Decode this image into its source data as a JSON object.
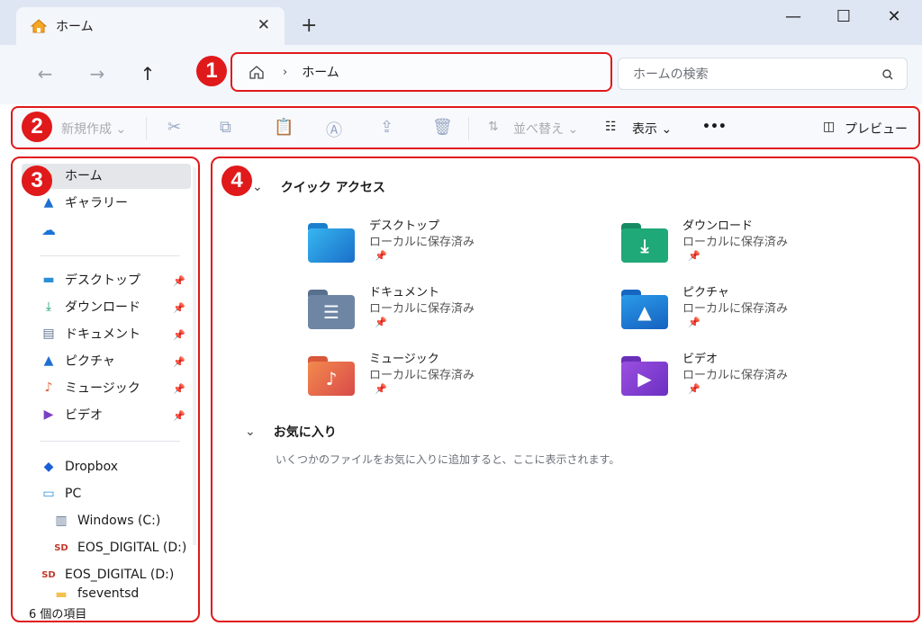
{
  "tab": {
    "title": "ホーム",
    "close": "✕",
    "new": "+"
  },
  "window": {
    "minimize": "—",
    "maximize": "☐",
    "close": "✕"
  },
  "nav": {
    "back": "←",
    "forward": "→",
    "up": "↑"
  },
  "address": {
    "sep": "›",
    "crumb": "ホーム"
  },
  "search": {
    "placeholder": "ホームの検索"
  },
  "markers": {
    "m1": "1",
    "m2": "2",
    "m3": "3",
    "m4": "4"
  },
  "toolbar": {
    "new_label": "新規作成 ⌄",
    "sort_label": "並べ替え ⌄",
    "view_label": "表示 ⌄",
    "more_label": "•••",
    "preview_label": "プレビュー"
  },
  "sidebar": {
    "home": "ホーム",
    "gallery": "ギャラリー",
    "pinned": [
      "デスクトップ",
      "ダウンロード",
      "ドキュメント",
      "ピクチャ",
      "ミュージック",
      "ビデオ"
    ],
    "dropbox": "Dropbox",
    "pc": "PC",
    "drive_c": "Windows (C:)",
    "drive_d1": "EOS_DIGITAL (D:)",
    "drive_d2": "EOS_DIGITAL (D:)",
    "fsevents": "fseventsd",
    "status": "6 個の項目"
  },
  "main": {
    "quick_access_title": "クイック アクセス",
    "favorites_title": "お気に入り",
    "favorites_empty": "いくつかのファイルをお気に入りに追加すると、ここに表示されます。",
    "items": [
      {
        "name": "デスクトップ",
        "status": "ローカルに保存済み"
      },
      {
        "name": "ダウンロード",
        "status": "ローカルに保存済み"
      },
      {
        "name": "ドキュメント",
        "status": "ローカルに保存済み"
      },
      {
        "name": "ピクチャ",
        "status": "ローカルに保存済み"
      },
      {
        "name": "ミュージック",
        "status": "ローカルに保存済み"
      },
      {
        "name": "ビデオ",
        "status": "ローカルに保存済み"
      }
    ]
  },
  "colors": {
    "accent_red": "#e0191b",
    "folder_blue": "#2b8fd6"
  }
}
